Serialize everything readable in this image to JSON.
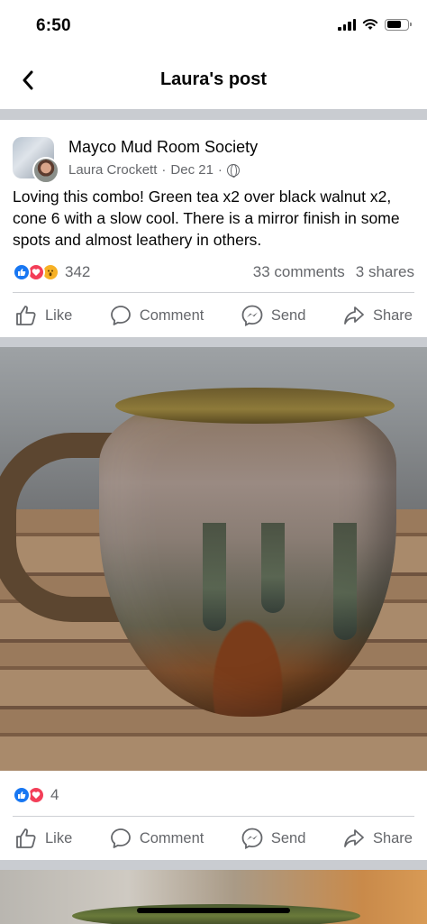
{
  "status_bar": {
    "time": "6:50"
  },
  "nav": {
    "title": "Laura's post"
  },
  "post": {
    "group_name": "Mayco Mud Room Society",
    "author": "Laura Crockett",
    "date": "Dec 21",
    "separator": "·",
    "text": "Loving this combo! Green tea x2 over black walnut x2, cone 6 with a slow cool. There is a mirror finish in some spots and almost leathery in others.",
    "reaction_count": "342",
    "comments": "33 comments",
    "shares": "3 shares"
  },
  "actions": {
    "like": "Like",
    "comment": "Comment",
    "send": "Send",
    "share": "Share"
  },
  "photo_1": {
    "reaction_count": "4"
  },
  "colors": {
    "facebook_blue": "#1877f2",
    "love_red": "#f33e58",
    "wow_yellow": "#f7b125",
    "secondary_text": "#65676b",
    "divider": "#c9ccd1"
  },
  "icons": [
    "back-chevron-icon",
    "globe-icon",
    "like-icon",
    "comment-icon",
    "messenger-send-icon",
    "share-icon",
    "signal-icon",
    "wifi-icon",
    "battery-icon"
  ]
}
